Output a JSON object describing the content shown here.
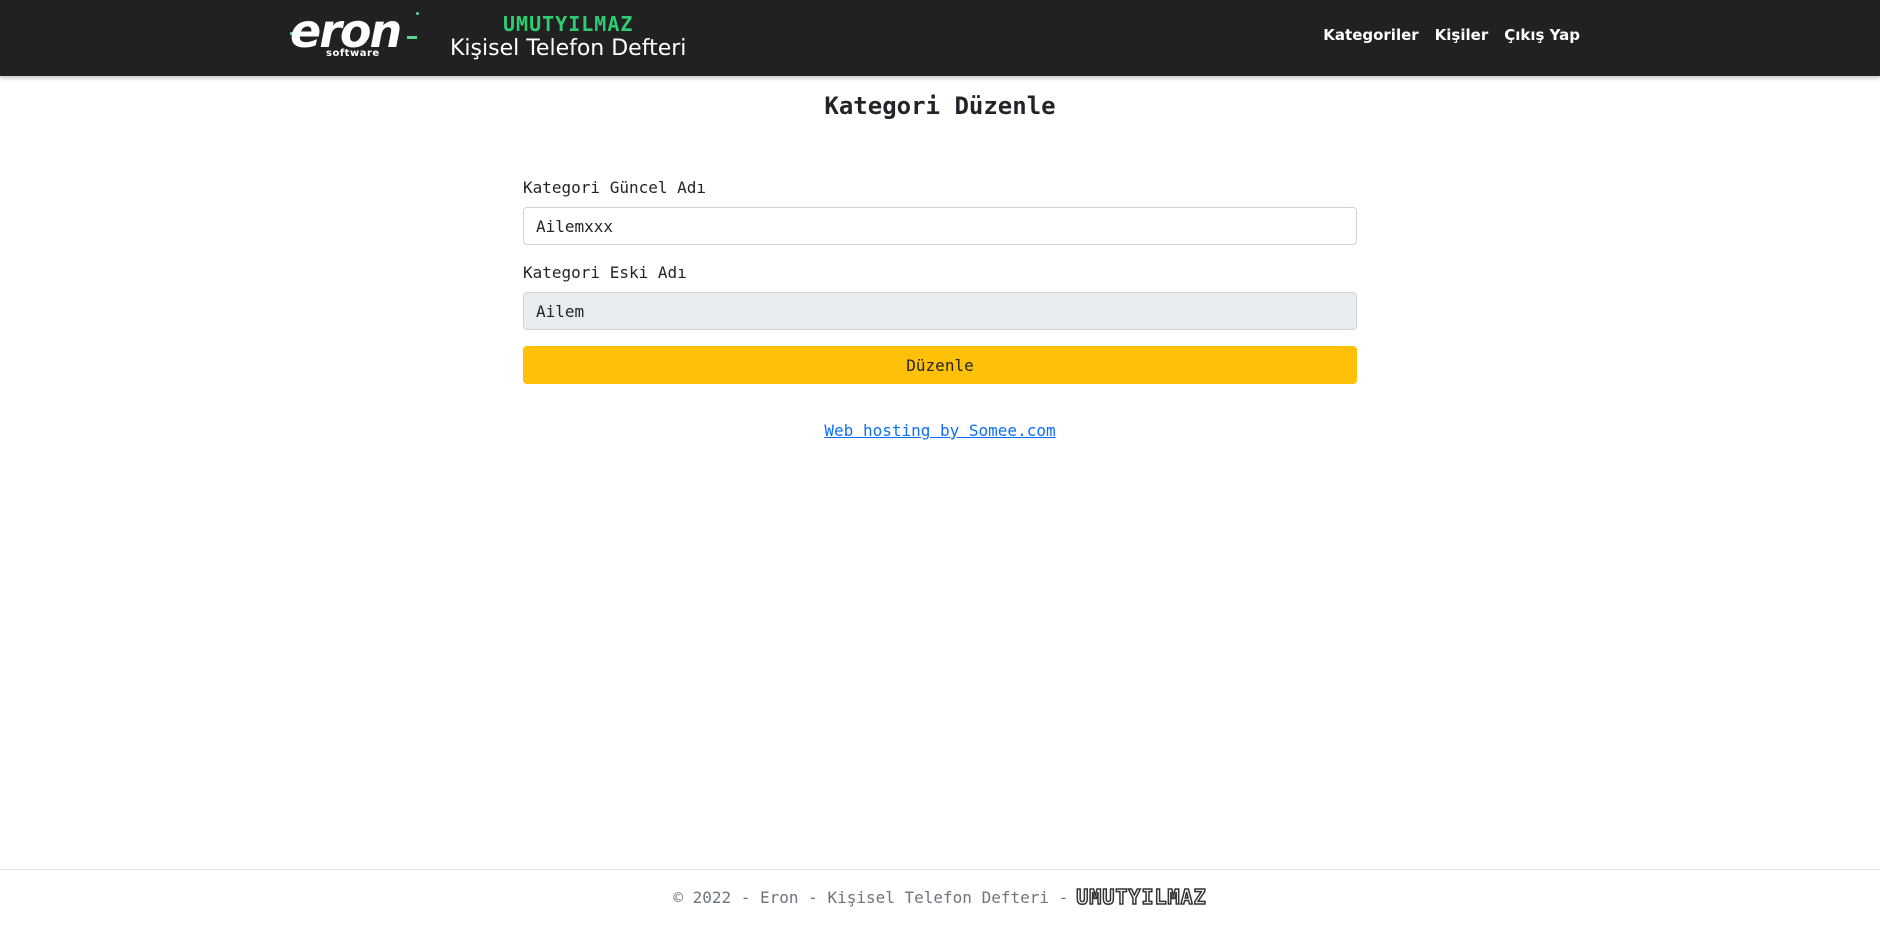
{
  "navbar": {
    "brand": {
      "logo_text": "eron",
      "logo_subtext": "software",
      "author": "UMUTYILMAZ",
      "app_title": "Kişisel Telefon Defteri"
    },
    "links": [
      {
        "label": "Kategoriler"
      },
      {
        "label": "Kişiler"
      },
      {
        "label": "Çıkış Yap"
      }
    ]
  },
  "main": {
    "title": "Kategori Düzenle",
    "fields": {
      "new_name": {
        "label": "Kategori Güncel Adı",
        "value": "Ailemxxx"
      },
      "old_name": {
        "label": "Kategori Eski Adı",
        "value": "Ailem"
      }
    },
    "submit_label": "Düzenle",
    "hosting_link": "Web hosting by Somee.com"
  },
  "footer": {
    "text": "© 2022 - Eron - Kişisel Telefon Defteri -",
    "author": "UMUTYILMAZ"
  },
  "colors": {
    "navbar_bg": "#212121",
    "accent_green": "#2ecc71",
    "button_warning": "#ffc107",
    "link_blue": "#0d6efd",
    "input_readonly_bg": "#e9ecef"
  }
}
